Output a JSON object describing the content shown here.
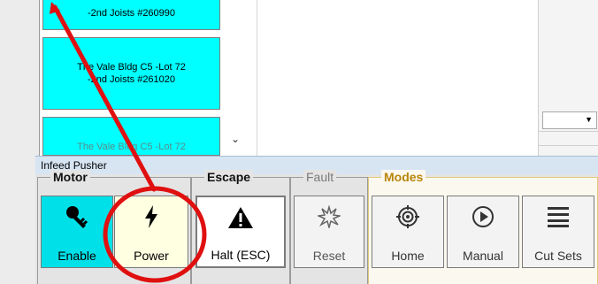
{
  "job_list": {
    "items": [
      {
        "label": "-2nd Joists #260990"
      },
      {
        "label": "The Vale Bldg C5 -Lot 72\n-2nd Joists #261020"
      },
      {
        "label": "The Vale Bldg C5 -Lot 72"
      }
    ]
  },
  "infeed": {
    "title": "Infeed Pusher",
    "groups": {
      "motor": "Motor",
      "escape": "Escape",
      "fault": "Fault",
      "modes": "Modes"
    },
    "buttons": {
      "enable": "Enable",
      "power": "Power",
      "halt": "Halt (ESC)",
      "reset": "Reset",
      "home": "Home",
      "manual": "Manual",
      "cut_sets": "Cut Sets"
    }
  },
  "colors": {
    "job_card": "#00ffff",
    "enable_bg": "#00e0e8",
    "power_bg": "#ffffe1",
    "modes_accent": "#b8860b",
    "annotation": "#e01010"
  },
  "icons": {
    "enable": "key-icon",
    "power": "lightning-bolt-icon",
    "halt": "warning-triangle-icon",
    "reset": "spark-burst-icon",
    "home": "target-icon",
    "manual": "play-circle-icon",
    "cut_sets": "list-lines-icon"
  }
}
